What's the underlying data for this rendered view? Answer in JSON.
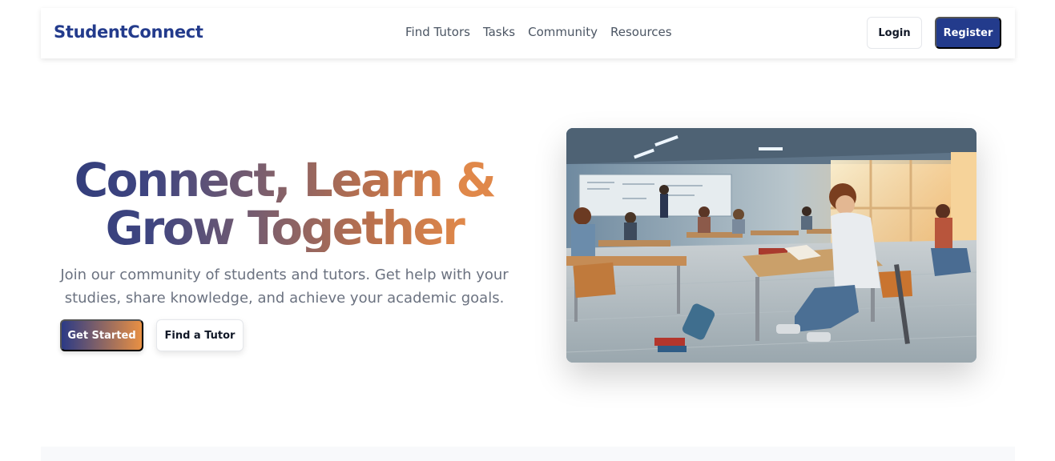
{
  "brand": {
    "name": "StudentConnect",
    "color": "#233b8c"
  },
  "nav": {
    "links": [
      "Find Tutors",
      "Tasks",
      "Community",
      "Resources"
    ],
    "login_label": "Login",
    "register_label": "Register"
  },
  "hero": {
    "title_line1": "Connect, Learn &",
    "title_line2": "Grow Together",
    "subtitle": "Join our community of students and tutors. Get help with your studies, share knowledge, and achieve your academic goals.",
    "primary_cta": "Get Started",
    "secondary_cta": "Find a Tutor",
    "image": "classroom-illustration"
  },
  "colors": {
    "accent_blue": "#233b8c",
    "accent_orange": "#e99043"
  }
}
